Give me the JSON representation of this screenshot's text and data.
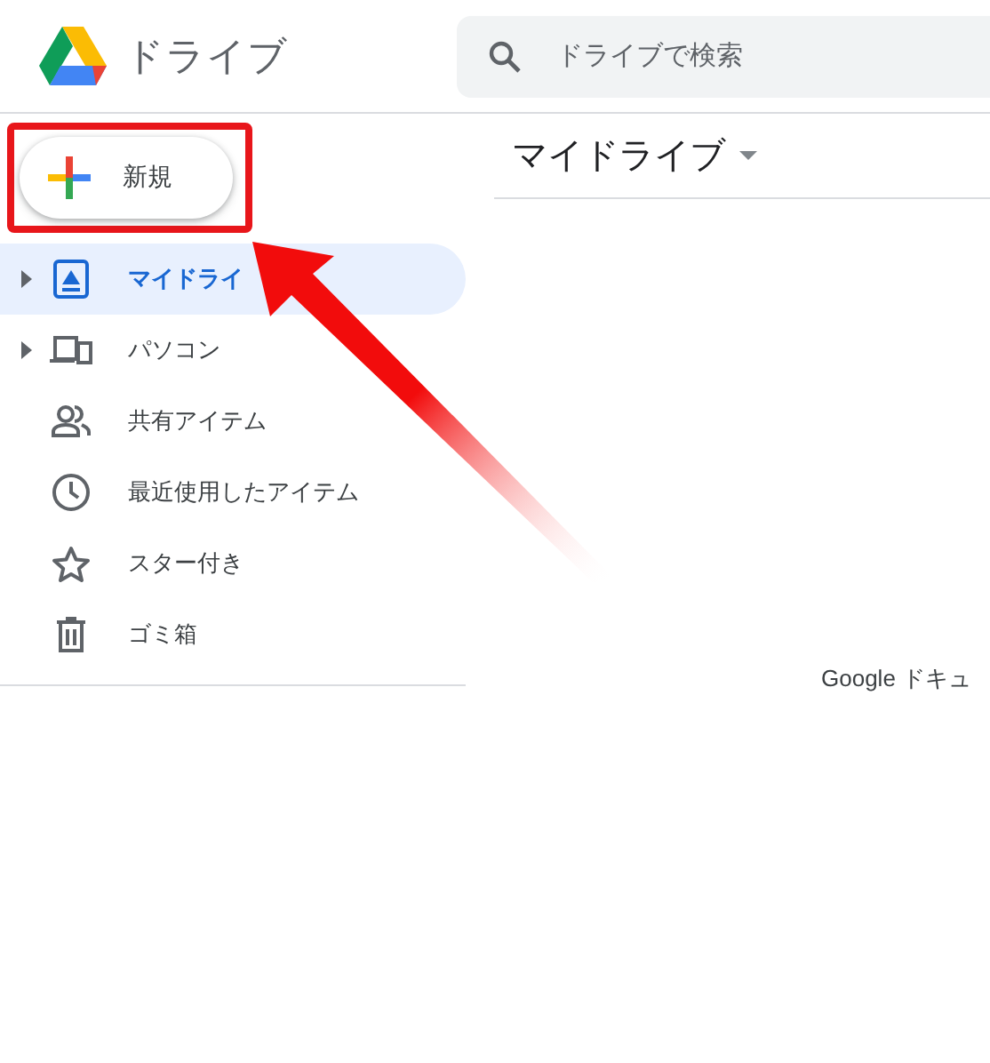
{
  "header": {
    "app_title": "ドライブ",
    "search": {
      "placeholder": "ドライブで検索"
    }
  },
  "sidebar": {
    "new_button": {
      "label": "新規",
      "highlighted": true
    },
    "items": [
      {
        "label": "マイドライ",
        "selected": true,
        "expandable": true
      },
      {
        "label": "パソコン",
        "selected": false,
        "expandable": true
      },
      {
        "label": "共有アイテム",
        "selected": false,
        "expandable": false
      },
      {
        "label": "最近使用したアイテム",
        "selected": false,
        "expandable": false
      },
      {
        "label": "スター付き",
        "selected": false,
        "expandable": false
      },
      {
        "label": "ゴミ箱",
        "selected": false,
        "expandable": false
      }
    ]
  },
  "main": {
    "title": "マイドライブ",
    "footer_text": "Google ドキュ"
  }
}
